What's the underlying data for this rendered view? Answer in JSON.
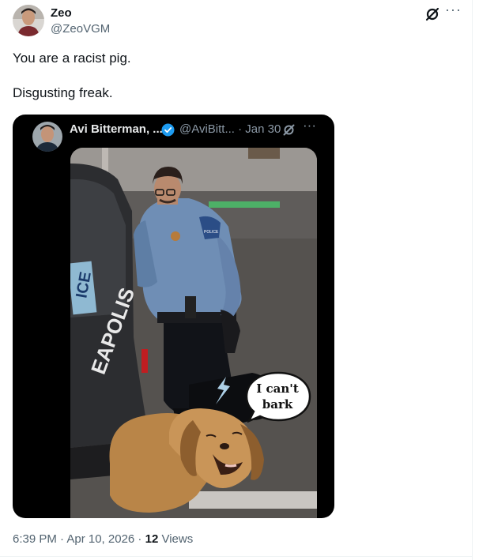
{
  "tweet": {
    "author_name": "Zeo",
    "author_handle": "@ZeoVGM",
    "text_line1": "You are a racist pig.",
    "text_line2": "Disgusting freak.",
    "timestamp": "6:39 PM · Apr 10, 2026",
    "separator": " · ",
    "views_count": "12",
    "views_label": " Views",
    "more_label": "···",
    "grok_icon": "grok-icon"
  },
  "quote": {
    "author_name": "Avi Bitterman, ...",
    "author_handle": "@AviBitt...",
    "date": "· Jan 30",
    "more_label": "···",
    "verified_icon": "verified-badge-icon",
    "verified_color": "#1d9bf0",
    "image": {
      "car_plate_text": "ICE",
      "car_lettering": "EAPOLIS",
      "badge_text": "POLICE",
      "speech_line1": "I can't",
      "speech_line2": "bark"
    }
  }
}
